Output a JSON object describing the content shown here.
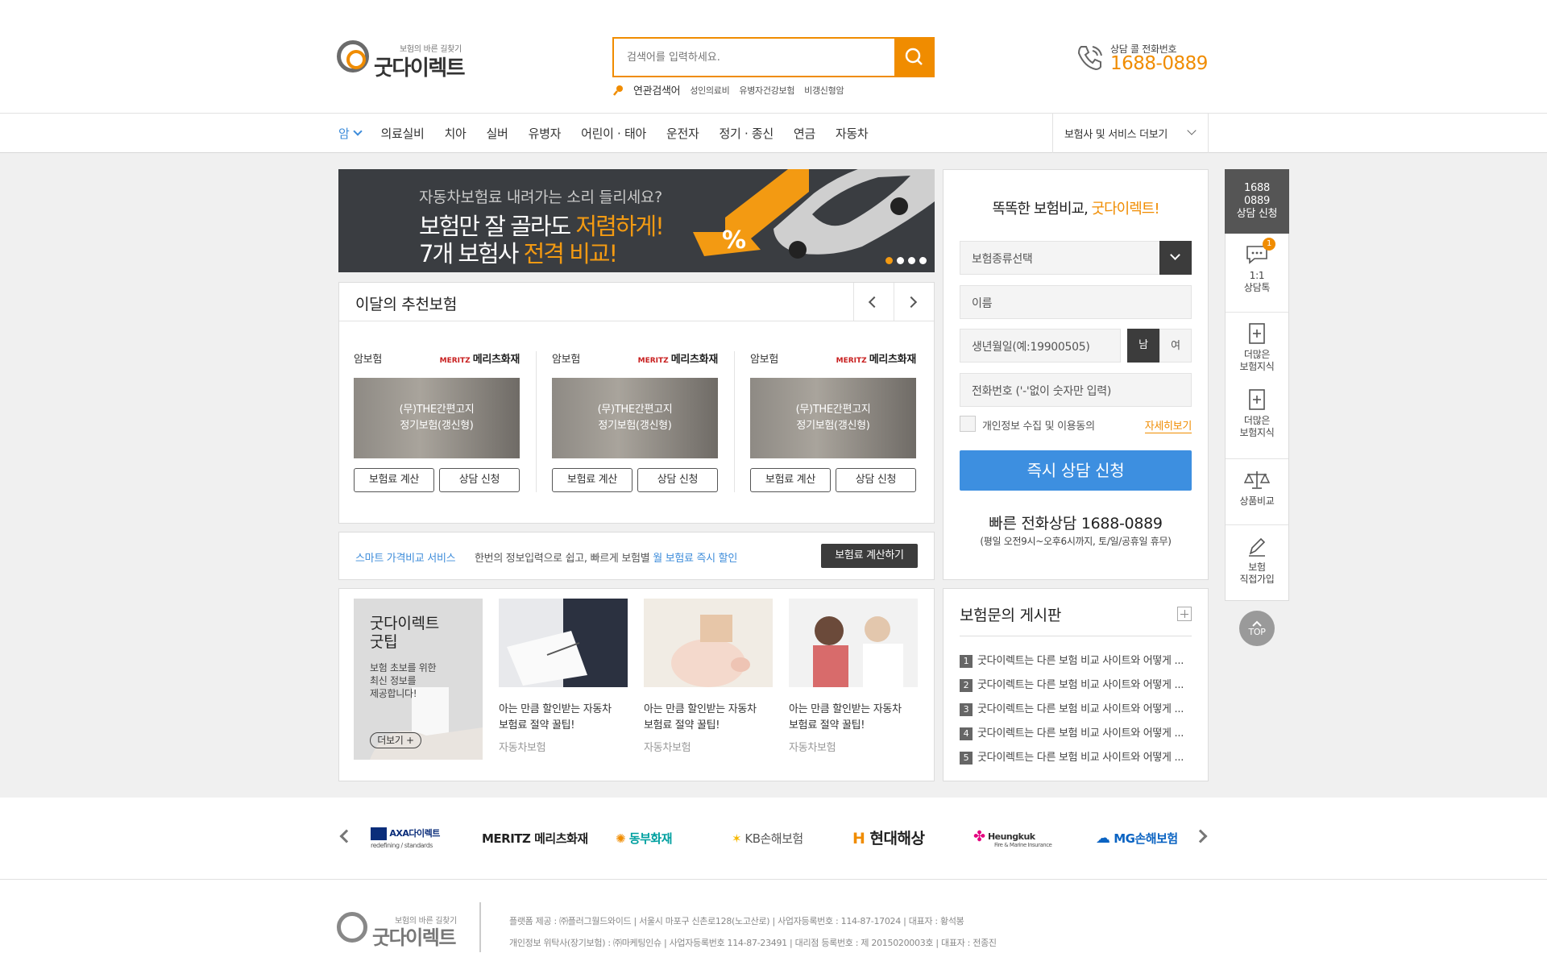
{
  "header": {
    "logo_tagline": "보험의 바른 길찾기",
    "logo_name": "굿다이렉트",
    "search_placeholder": "검색어를 입력하세요.",
    "related_label": "연관검색어",
    "related_keywords": [
      "성인의료비",
      "유병자건강보험",
      "비갱신형암"
    ],
    "phone_label": "상담 콜 전화번호",
    "phone_number": "1688-0889"
  },
  "nav": {
    "items": [
      "암",
      "의료실비",
      "치아",
      "실버",
      "유병자",
      "어린이 · 태아",
      "운전자",
      "정기 · 종신",
      "연금",
      "자동차"
    ],
    "active_index": 0,
    "more_services": "보험사 및 서비스 더보기"
  },
  "banner": {
    "line1": "자동차보험료 내려가는 소리 들리세요?",
    "line2_a": "보험만 잘 골라도 ",
    "line2_b": "저렴하게!",
    "line3_a": "7개 보험사 ",
    "line3_b": "전격 비교!",
    "slide_count": 4,
    "active_slide": 0
  },
  "recommended": {
    "title": "이달의 추천보험",
    "cards": [
      {
        "category": "암보험",
        "insurer_mark": "MERITZ",
        "insurer": "메리츠화재",
        "caption1": "(무)THE간편고지",
        "caption2": "정기보험(갱신형)",
        "btn_calc": "보험료 계산",
        "btn_apply": "상담 신청"
      },
      {
        "category": "암보험",
        "insurer_mark": "MERITZ",
        "insurer": "메리츠화재",
        "caption1": "(무)THE간편고지",
        "caption2": "정기보험(갱신형)",
        "btn_calc": "보험료 계산",
        "btn_apply": "상담 신청"
      },
      {
        "category": "암보험",
        "insurer_mark": "MERITZ",
        "insurer": "메리츠화재",
        "caption1": "(무)THE간편고지",
        "caption2": "정기보험(갱신형)",
        "btn_calc": "보험료 계산",
        "btn_apply": "상담 신청"
      }
    ]
  },
  "smart": {
    "label": "스마트 가격비교 서비스",
    "desc_a": "한번의 정보입력으로 쉽고, 빠르게 보험별 ",
    "desc_b": "월 보험료 즉시 할인",
    "button": "보험료 계산하기"
  },
  "tips": {
    "box_title1": "굿다이렉트",
    "box_title2": "굿팁",
    "box_sub1": "보험 초보를 위한",
    "box_sub2": "최신 정보를",
    "box_sub3": "제공합니다!",
    "box_more": "더보기 +",
    "cards": [
      {
        "title1": "아는 만큼 할인받는 자동차",
        "title2": "보험료 절약 꿀팁!",
        "category": "자동차보험"
      },
      {
        "title1": "아는 만큼 할인받는 자동차",
        "title2": "보험료 절약 꿀팁!",
        "category": "자동차보험"
      },
      {
        "title1": "아는 만큼 할인받는 자동차",
        "title2": "보험료 절약 꿀팁!",
        "category": "자동차보험"
      }
    ]
  },
  "form": {
    "title_a": "똑똑한 보험비교, ",
    "title_b": "굿다이렉트!",
    "select_label": "보험종류선택",
    "name_placeholder": "이름",
    "birth_placeholder": "생년월일(예:19900505)",
    "male": "남",
    "female": "여",
    "phone_placeholder": "전화번호 ('-'없이 숫자만 입력)",
    "consent": "개인정보 수집 및 이용동의",
    "detail": "자세히보기",
    "submit": "즉시 상담 신청",
    "quick": "빠른 전화상담 1688-0889",
    "hours": "(평일 오전9시~오후6시까지, 토/일/공휴일 휴무)"
  },
  "board": {
    "title": "보험문의 게시판",
    "posts": [
      "굿다이렉트는 다른 보험 비교 사이트와 어떻게 ...",
      "굿다이렉트는 다른 보험 비교 사이트와 어떻게 ...",
      "굿다이렉트는 다른 보험 비교 사이트와 어떻게 ...",
      "굿다이렉트는 다른 보험 비교 사이트와 어떻게 ...",
      "굿다이렉트는 다른 보험 비교 사이트와 어떻게 ..."
    ]
  },
  "side": {
    "top1": "1688",
    "top2": "0889",
    "top3": "상담 신청",
    "chat1": "1:1",
    "chat2": "상담톡",
    "badge": "1",
    "know1a": "더많은",
    "know1b": "보험지식",
    "know2a": "더많은",
    "know2b": "보험지식",
    "compare": "상품비교",
    "direct1": "보험",
    "direct2": "직접가입",
    "top_btn": "TOP"
  },
  "partners": [
    "AXA다이렉트",
    "MERITZ 메리츠화재",
    "동부화재",
    "KB손해보험",
    "현대해상",
    "Heungkuk",
    "MG손해보험"
  ],
  "partners_sub": {
    "axa": "redefining / standards",
    "heungkuk": "Fire & Marine Insurance"
  },
  "footer": {
    "line1": "플랫폼 제공 : ㈜플러그월드와이드  |  서울시 마포구 신촌로128(노고산로)  |  사업자등록번호 : 114-87-17024  |  대표자 : 황석봉",
    "line2": "개인정보 위탁사(장기보험) : ㈜마케팅인슈  |  사업자등록번호 114-87-23491  |  대리점 등록번호 : 제 2015020003호  |  대표자 : 전종진"
  },
  "colors": {
    "accent": "#f08c00",
    "blue": "#3d8fe0",
    "dark": "#3c3c3c"
  }
}
